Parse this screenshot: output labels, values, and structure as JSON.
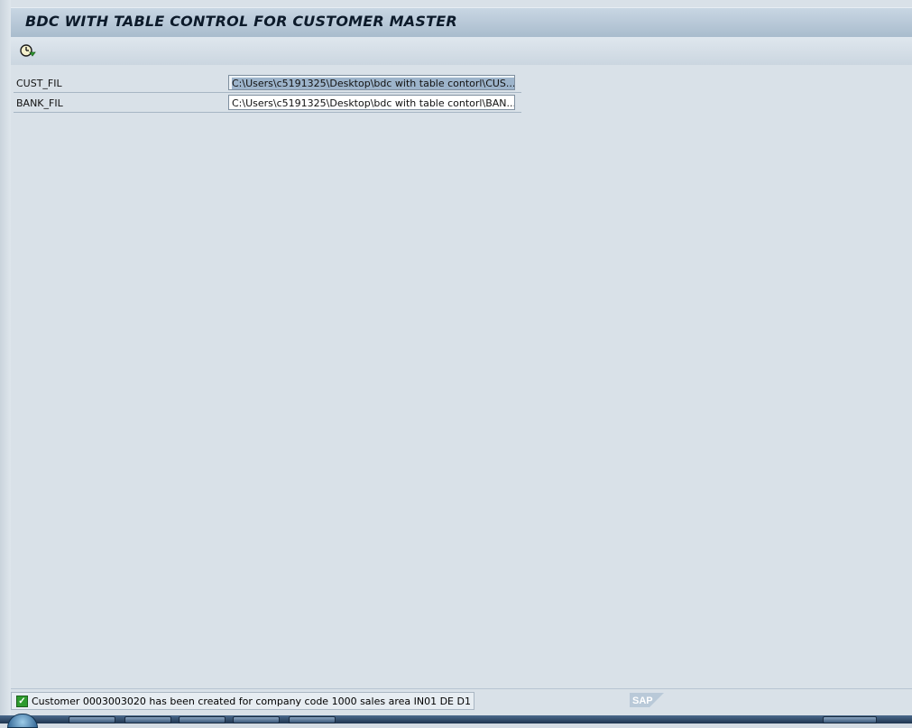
{
  "window": {
    "title": "BDC WITH TABLE CONTROL FOR CUSTOMER MASTER"
  },
  "toolbar": {
    "execute_icon": "execute-clock-icon"
  },
  "form": {
    "fields": [
      {
        "label": "CUST_FIL",
        "value": "C:\\Users\\c5191325\\Desktop\\bdc with table contorl\\CUS...",
        "selected": true
      },
      {
        "label": "BANK_FIL",
        "value": "C:\\Users\\c5191325\\Desktop\\bdc with table contorl\\BAN...",
        "selected": false
      }
    ]
  },
  "status": {
    "icon": "success-check-icon",
    "message": "Customer 0003003020 has been created for company code 1000 sales area IN01 DE D1"
  },
  "brand": {
    "logo_text": "SAP",
    "logo_color": "#b9c9d8"
  },
  "taskbar": {
    "items": [
      "excel-icon",
      "word-icon",
      "visual-studio-icon",
      "chrome-icon",
      "explorer-icon"
    ]
  }
}
